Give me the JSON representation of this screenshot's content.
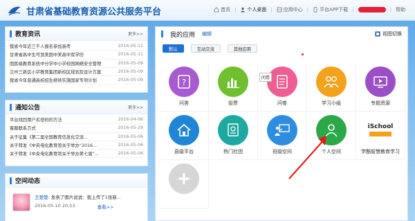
{
  "header": {
    "site_title": "甘肃省基础教育资源公共服务平台",
    "nav": [
      {
        "label": "首页",
        "icon": "home-icon"
      },
      {
        "label": "个人桌面",
        "icon": "user-icon"
      },
      {
        "label": "应用中心",
        "icon": "apps-icon"
      },
      {
        "label": "平台APP下载",
        "icon": "mobile-icon"
      },
      {
        "label": "帮助",
        "icon": ""
      }
    ]
  },
  "news": {
    "title": "教育资讯",
    "more": "更多>>",
    "items": [
      {
        "text": "我省今年近三千人报名参加高考",
        "date": "2016-05-11"
      },
      {
        "text": "甘肃省高中生可到美国中美高中双学历",
        "date": "2016-05-11"
      },
      {
        "text": "国民级教育系统中分学中小学校园网络安全管理",
        "date": "2016-05-09"
      },
      {
        "text": "兰州三新区小学教育集团新校区规划及设计方案",
        "date": "2016-05-09"
      },
      {
        "text": "我省今年普通高校招生继续实施国家专项计划",
        "date": "2016-05-09"
      }
    ]
  },
  "notices": {
    "title": "通知公告",
    "more": "更多>>",
    "items": [
      {
        "text": "平台找回用户名密码的方法",
        "date": "2016-04-06"
      },
      {
        "text": "客服联系方式",
        "date": "2016-05-29"
      },
      {
        "text": "关于征集《第二届全国教育信息化交流...",
        "date": "2016-05-06"
      },
      {
        "text": "关于转发《中央电化教育馆关于举办“2016...",
        "date": "2016-05-06"
      },
      {
        "text": "关于转发《中央电化教育馆关于举办第七届“...",
        "date": "2016-05-06"
      }
    ]
  },
  "space": {
    "title": "空间动态",
    "post_user": "王楚楚:",
    "post_text": "发表了图片说说：我上传了1张新...",
    "post_date": "2016-05-10 20:53",
    "view_label": "查看>>"
  },
  "apps": {
    "title": "我的应用",
    "edit_label": "编辑",
    "switch_label": "视图切换",
    "filters": [
      "默认",
      "互动交流",
      "其他应用"
    ],
    "active_filter": "默认",
    "tooltip": "问卷",
    "tiles": [
      {
        "label": "问答",
        "icon": "question-icon",
        "color": "#a85bd1"
      },
      {
        "label": "投票",
        "icon": "bar-chart-icon",
        "color": "#6fbf2f"
      },
      {
        "label": "问卷",
        "icon": "checklist-icon",
        "color": "#ee5e92"
      },
      {
        "label": "学习小组",
        "icon": "group-icon",
        "color": "#f2a21b"
      },
      {
        "label": "专题资源",
        "icon": "video-icon",
        "color": "#9b4fc6"
      },
      {
        "label": "县级平台",
        "icon": "house-icon",
        "color": "#1f86d6"
      },
      {
        "label": "热门社团",
        "icon": "certificate-icon",
        "color": "#1ea9a0"
      },
      {
        "label": "班级空间",
        "icon": "classroom-icon",
        "color": "#2f8de0"
      },
      {
        "label": "个人空间",
        "icon": "person-icon",
        "color": "#2aa84a"
      },
      {
        "label": "学酷智慧教育学习",
        "icon": "xueku-logo-icon",
        "color": "#ffffff"
      },
      {
        "label": "",
        "icon": "add-icon",
        "color": "#cccccc"
      }
    ]
  }
}
